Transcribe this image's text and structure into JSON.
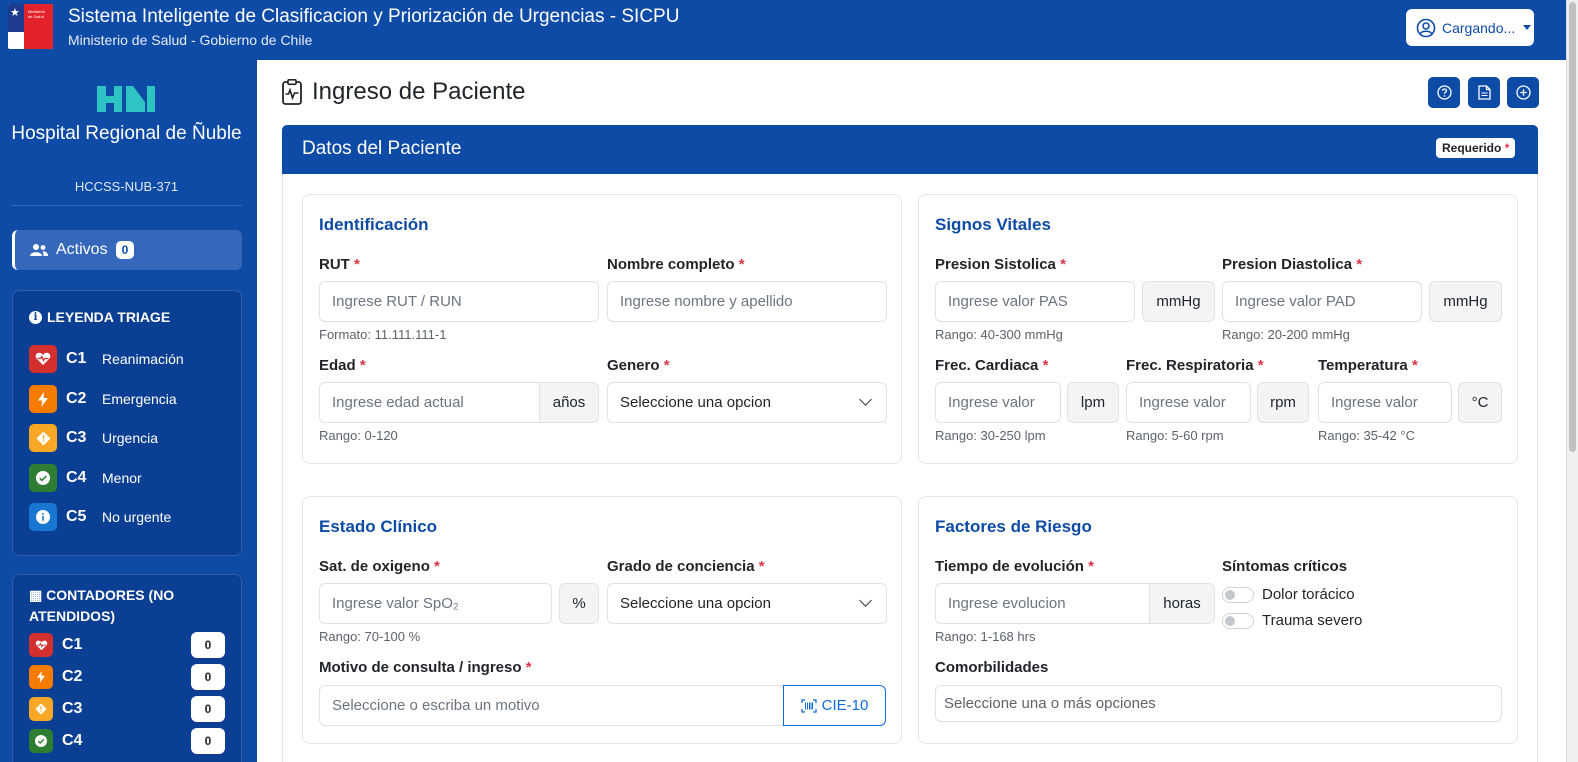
{
  "header": {
    "logo_text": "Ministerio de Salud",
    "title": "Sistema Inteligente de Clasificacion y Priorización de Urgencias - SICPU",
    "subtitle": "Ministerio de Salud - Gobierno de Chile",
    "user_button": "Cargando..."
  },
  "sidebar": {
    "hospital_name": "Hospital Regional de Ñuble",
    "hospital_code": "HCCSS-NUB-371",
    "activos_label": "Activos",
    "activos_count": "0",
    "legend_title": "LEYENDA TRIAGE",
    "legend": [
      {
        "code": "C1",
        "desc": "Reanimación",
        "color": "#d32f2f",
        "icon": "heart-pulse-icon"
      },
      {
        "code": "C2",
        "desc": "Emergencia",
        "color": "#f57c00",
        "icon": "lightning-icon"
      },
      {
        "code": "C3",
        "desc": "Urgencia",
        "color": "#f9a825",
        "icon": "warning-diamond-icon"
      },
      {
        "code": "C4",
        "desc": "Menor",
        "color": "#2e7d32",
        "icon": "check-circle-icon"
      },
      {
        "code": "C5",
        "desc": "No urgente",
        "color": "#1976d2",
        "icon": "info-circle-icon"
      }
    ],
    "counters_title": "CONTADORES (NO ATENDIDOS)",
    "counters": [
      {
        "code": "C1",
        "count": "0"
      },
      {
        "code": "C2",
        "count": "0"
      },
      {
        "code": "C3",
        "count": "0"
      },
      {
        "code": "C4",
        "count": "0"
      }
    ]
  },
  "main": {
    "page_title": "Ingreso de Paciente",
    "card_title": "Datos del Paciente",
    "required_badge": "Requerido",
    "identificacion": {
      "title": "Identificación",
      "rut_label": "RUT",
      "rut_placeholder": "Ingrese RUT / RUN",
      "rut_help": "Formato: 11.111.111-1",
      "nombre_label": "Nombre completo",
      "nombre_placeholder": "Ingrese nombre y apellido",
      "edad_label": "Edad",
      "edad_placeholder": "Ingrese edad actual",
      "edad_unit": "años",
      "edad_help": "Rango: 0-120",
      "genero_label": "Genero",
      "genero_value": "Seleccione una opcion"
    },
    "signos": {
      "title": "Signos Vitales",
      "pas_label": "Presion Sistolica",
      "pas_placeholder": "Ingrese valor PAS",
      "pas_unit": "mmHg",
      "pas_help": "Rango: 40-300 mmHg",
      "pad_label": "Presion Diastolica",
      "pad_placeholder": "Ingrese valor PAD",
      "pad_unit": "mmHg",
      "pad_help": "Rango: 20-200 mmHg",
      "fc_label": "Frec. Cardiaca",
      "fc_placeholder": "Ingrese valor",
      "fc_unit": "lpm",
      "fc_help": "Rango: 30-250 lpm",
      "fr_label": "Frec. Respiratoria",
      "fr_placeholder": "Ingrese valor",
      "fr_unit": "rpm",
      "fr_help": "Rango: 5-60 rpm",
      "temp_label": "Temperatura",
      "temp_placeholder": "Ingrese valor",
      "temp_unit": "°C",
      "temp_help": "Rango: 35-42 °C"
    },
    "estado": {
      "title": "Estado Clínico",
      "sat_label": "Sat. de oxigeno",
      "sat_placeholder": "Ingrese valor SpO₂",
      "sat_unit": "%",
      "sat_help": "Rango: 70-100 %",
      "conciencia_label": "Grado de conciencia",
      "conciencia_value": "Seleccione una opcion",
      "motivo_label": "Motivo de consulta / ingreso",
      "motivo_placeholder": "Seleccione o escriba un motivo",
      "cie_button": "CIE-10"
    },
    "riesgo": {
      "title": "Factores de Riesgo",
      "tiempo_label": "Tiempo de evolución",
      "tiempo_placeholder": "Ingrese evolucion",
      "tiempo_unit": "horas",
      "tiempo_help": "Rango: 1-168 hrs",
      "sintomas_label": "Síntomas críticos",
      "sintoma_1": "Dolor torácico",
      "sintoma_2": "Trauma severo",
      "comorb_label": "Comorbilidades",
      "comorb_placeholder": "Seleccione una o más opciones"
    }
  }
}
